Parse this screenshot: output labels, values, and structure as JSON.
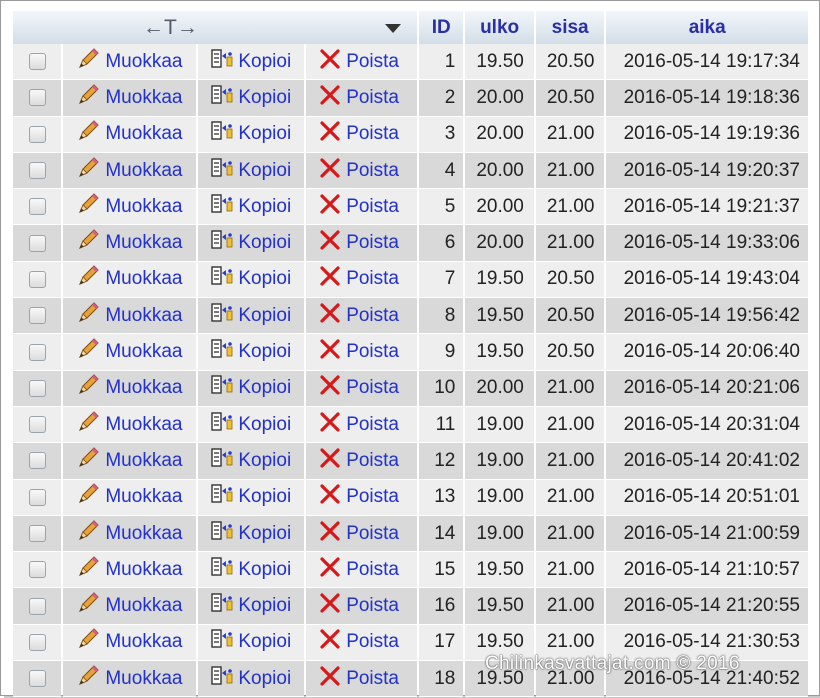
{
  "table": {
    "headers": {
      "controls_arrows": "←T→",
      "id": "ID",
      "ulko": "ulko",
      "sisa": "sisa",
      "aika": "aika"
    },
    "actions": {
      "edit": "Muokkaa",
      "copy": "Kopioi",
      "delete": "Poista"
    },
    "rows": [
      {
        "id": "1",
        "ulko": "19.50",
        "sisa": "20.50",
        "aika": "2016-05-14 19:17:34"
      },
      {
        "id": "2",
        "ulko": "20.00",
        "sisa": "20.50",
        "aika": "2016-05-14 19:18:36"
      },
      {
        "id": "3",
        "ulko": "20.00",
        "sisa": "21.00",
        "aika": "2016-05-14 19:19:36"
      },
      {
        "id": "4",
        "ulko": "20.00",
        "sisa": "21.00",
        "aika": "2016-05-14 19:20:37"
      },
      {
        "id": "5",
        "ulko": "20.00",
        "sisa": "21.00",
        "aika": "2016-05-14 19:21:37"
      },
      {
        "id": "6",
        "ulko": "20.00",
        "sisa": "21.00",
        "aika": "2016-05-14 19:33:06"
      },
      {
        "id": "7",
        "ulko": "19.50",
        "sisa": "20.50",
        "aika": "2016-05-14 19:43:04"
      },
      {
        "id": "8",
        "ulko": "19.50",
        "sisa": "20.50",
        "aika": "2016-05-14 19:56:42"
      },
      {
        "id": "9",
        "ulko": "19.50",
        "sisa": "20.50",
        "aika": "2016-05-14 20:06:40"
      },
      {
        "id": "10",
        "ulko": "20.00",
        "sisa": "21.00",
        "aika": "2016-05-14 20:21:06"
      },
      {
        "id": "11",
        "ulko": "19.00",
        "sisa": "21.00",
        "aika": "2016-05-14 20:31:04"
      },
      {
        "id": "12",
        "ulko": "19.00",
        "sisa": "21.00",
        "aika": "2016-05-14 20:41:02"
      },
      {
        "id": "13",
        "ulko": "19.00",
        "sisa": "21.00",
        "aika": "2016-05-14 20:51:01"
      },
      {
        "id": "14",
        "ulko": "19.00",
        "sisa": "21.00",
        "aika": "2016-05-14 21:00:59"
      },
      {
        "id": "15",
        "ulko": "19.50",
        "sisa": "21.00",
        "aika": "2016-05-14 21:10:57"
      },
      {
        "id": "16",
        "ulko": "19.50",
        "sisa": "21.00",
        "aika": "2016-05-14 21:20:55"
      },
      {
        "id": "17",
        "ulko": "19.50",
        "sisa": "21.00",
        "aika": "2016-05-14 21:30:53"
      },
      {
        "id": "18",
        "ulko": "19.50",
        "sisa": "21.00",
        "aika": "2016-05-14 21:40:52"
      }
    ]
  },
  "watermark": "Chilinkasvattajat.com © 2016",
  "colors": {
    "header_text": "#2a2fa8",
    "link": "#2230cc",
    "row_odd": "#eeeeee",
    "row_even": "#d9d9d9",
    "delete_icon": "#d81818"
  },
  "icons": {
    "edit": "pencil-icon",
    "copy": "copy-icon",
    "delete": "delete-x-icon",
    "dropdown": "dropdown-triangle-icon"
  }
}
